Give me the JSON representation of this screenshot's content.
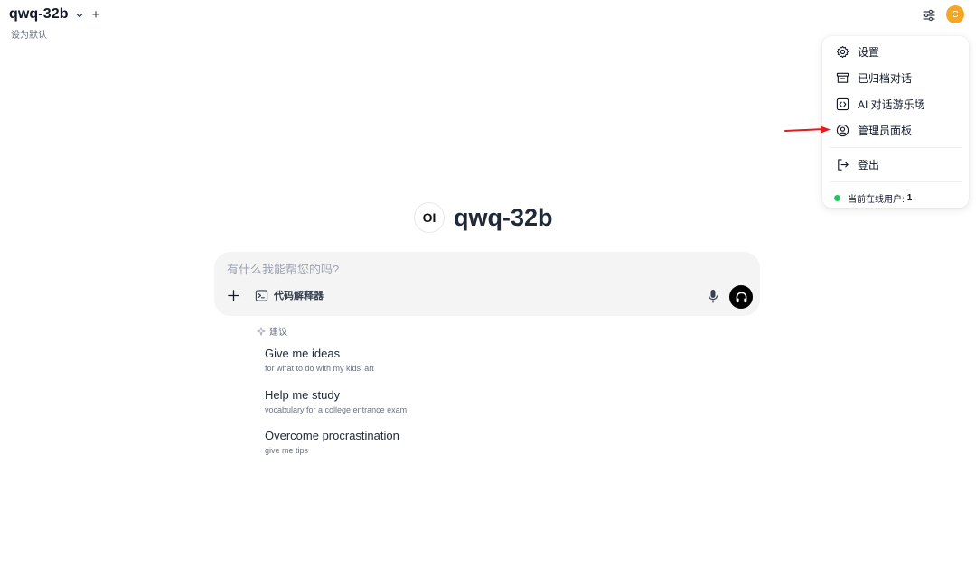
{
  "header": {
    "model_name": "qwq-32b",
    "set_default": "设为默认",
    "new_model": "+",
    "avatar_letter": "C",
    "avatar_color": "#f5a623"
  },
  "menu": {
    "items": [
      {
        "label": "设置",
        "icon": "gear-icon"
      },
      {
        "label": "已归档对话",
        "icon": "archive-icon"
      },
      {
        "label": "AI 对话游乐场",
        "icon": "code-icon"
      },
      {
        "label": "管理员面板",
        "icon": "user-circle-icon"
      },
      {
        "label": "登出",
        "icon": "sign-out-icon"
      }
    ],
    "online_label": "当前在线用户:",
    "online_count": "1",
    "online_color": "#22c55e"
  },
  "hero": {
    "logo_text": "OI",
    "title": "qwq-32b"
  },
  "chat": {
    "placeholder": "有什么我能帮您的吗?",
    "code_interpreter_label": "代码解释器"
  },
  "suggestions": {
    "header": "建议",
    "items": [
      {
        "title": "Give me ideas",
        "subtitle": "for what to do with my kids' art"
      },
      {
        "title": "Help me study",
        "subtitle": "vocabulary for a college entrance exam"
      },
      {
        "title": "Overcome procrastination",
        "subtitle": "give me tips"
      }
    ]
  },
  "annotation": {
    "arrow_color": "#e11d1d"
  }
}
